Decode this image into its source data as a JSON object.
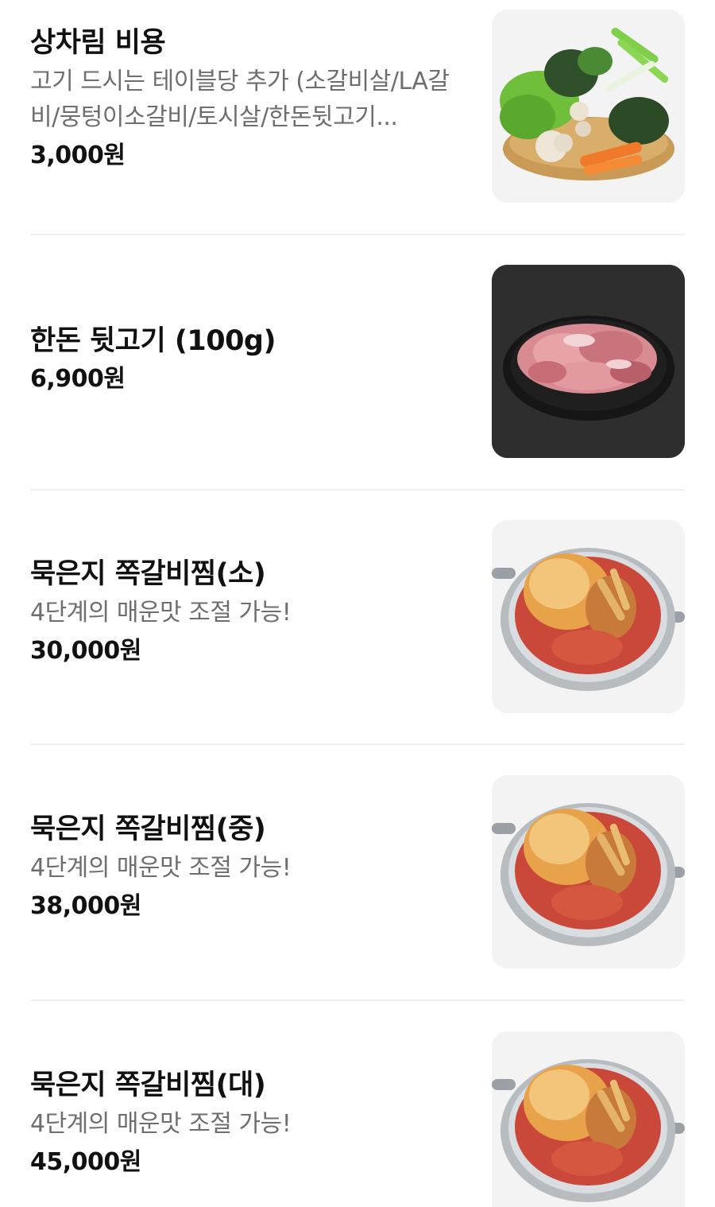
{
  "menu": {
    "items": [
      {
        "name": "상차림 비용",
        "description": "고기 드시는 테이블당 추가 (소갈비살/LA갈비/뭉텅이소갈비/토시살/한돈뒷고기...",
        "price": "3,000원",
        "image": "vegetable-basket-photo"
      },
      {
        "name": "한돈 뒷고기 (100g)",
        "price": "6,900원",
        "image": "raw-pork-plate-photo"
      },
      {
        "name": "묵은지 쪽갈비찜(소)",
        "description": "4단계의 매운맛 조절 가능!",
        "price": "30,000원",
        "image": "kimchi-rib-stew-pot-photo"
      },
      {
        "name": "묵은지 쪽갈비찜(중)",
        "description": "4단계의 매운맛 조절 가능!",
        "price": "38,000원",
        "image": "kimchi-rib-stew-pot-photo"
      },
      {
        "name": "묵은지 쪽갈비찜(대)",
        "description": "4단계의 매운맛 조절 가능!",
        "price": "45,000원",
        "image": "kimchi-rib-stew-pot-photo"
      }
    ]
  },
  "colors": {
    "text_primary": "#111111",
    "text_secondary": "#6e6e6e",
    "divider": "#efefef",
    "thumb_bg": "#f3f3f3"
  }
}
